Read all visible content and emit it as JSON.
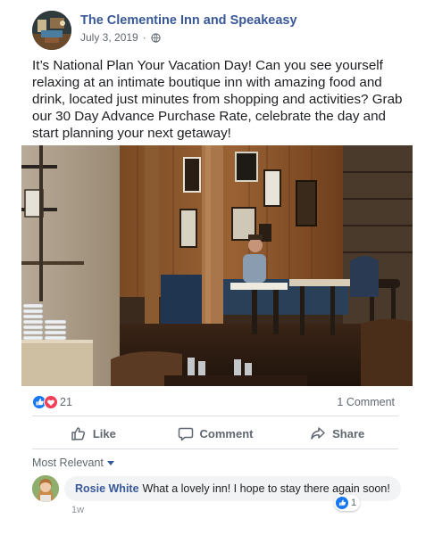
{
  "post": {
    "page_name": "The Clementine Inn and Speakeasy",
    "date": "July 3, 2019",
    "separator": "·",
    "privacy_icon": "globe-icon",
    "text": "It’s National Plan Your Vacation Day! Can you see yourself relaxing at an intimate boutique inn with amazing food and drink, located just minutes from shopping and activities? Grab our 30 Day Advance Purchase Rate, celebrate the day and start planning your next getaway!",
    "photo_icon": "restaurant-interior-photo"
  },
  "reactions": {
    "icons": [
      "like-reaction-icon",
      "love-reaction-icon"
    ],
    "count": "21",
    "comments_count": "1 Comment"
  },
  "actions": {
    "like": "Like",
    "comment": "Comment",
    "share": "Share"
  },
  "comments": {
    "sort_label": "Most Relevant",
    "items": [
      {
        "author": "Rosie White",
        "text": "What a lovely inn! I hope to stay there again soon!",
        "likes": "1",
        "time": "1w"
      }
    ]
  },
  "colors": {
    "link": "#385898",
    "like_blue": "#1877f2",
    "love_red": "#f33e58",
    "muted": "#606770",
    "bubble": "#f2f3f5"
  }
}
